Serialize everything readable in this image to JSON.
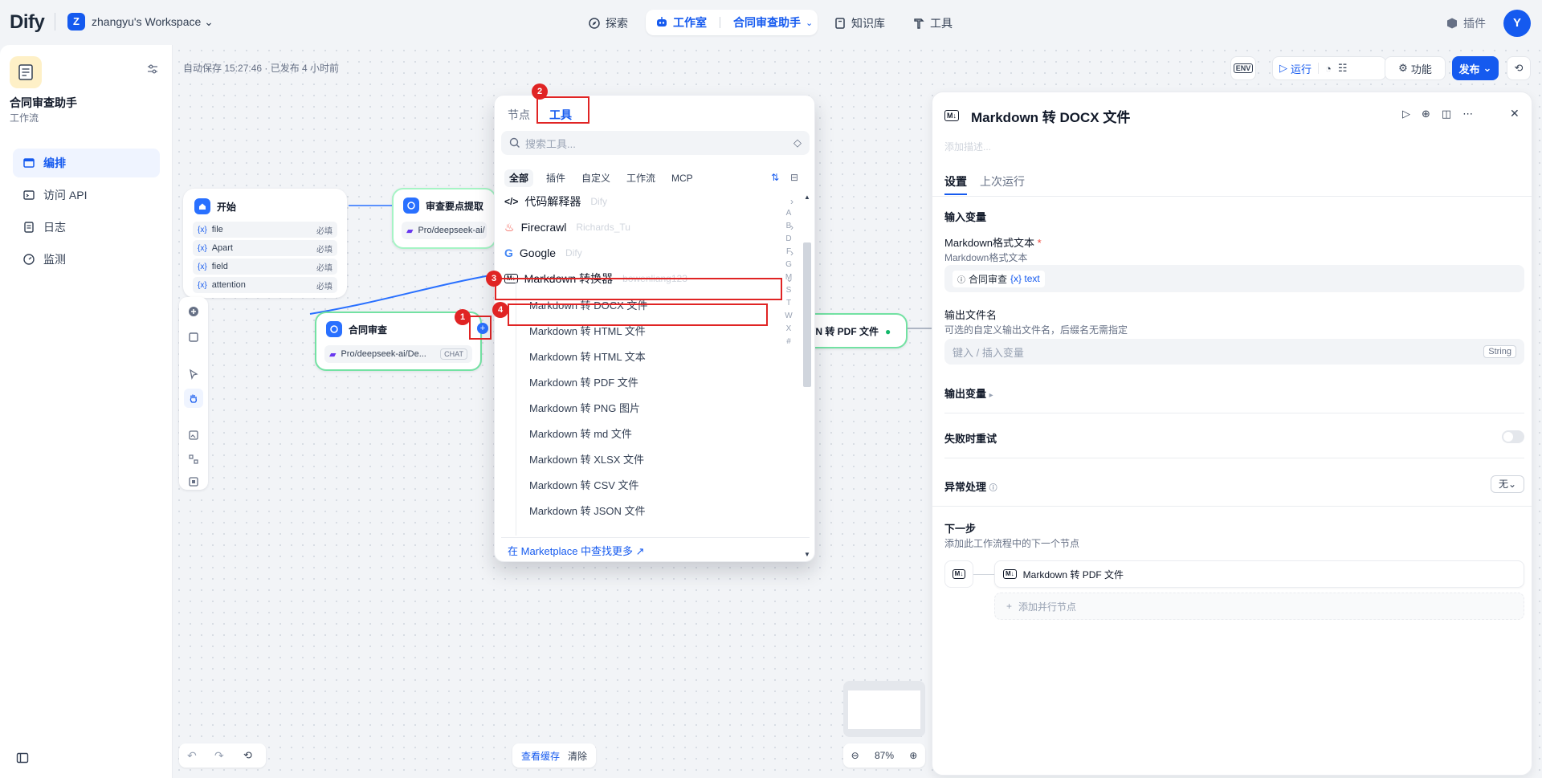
{
  "header": {
    "logo": "Dify",
    "workspace_initial": "Z",
    "workspace_name": "zhangyu's Workspace",
    "nav_explore": "探索",
    "nav_studio": "工作室",
    "nav_app": "合同审查助手",
    "nav_knowledge": "知识库",
    "nav_tools": "工具",
    "nav_plugins": "插件",
    "user_initial": "Y"
  },
  "sidebar": {
    "app_name": "合同审查助手",
    "app_type": "工作流",
    "items": [
      {
        "label": "编排"
      },
      {
        "label": "访问 API"
      },
      {
        "label": "日志"
      },
      {
        "label": "监测"
      }
    ]
  },
  "canvas": {
    "autosave": "自动保存 15:27:46 · 已发布 4 小时前",
    "start_node": {
      "title": "开始",
      "vars": [
        {
          "name": "file",
          "req": "必填"
        },
        {
          "name": "Apart",
          "req": "必填"
        },
        {
          "name": "field",
          "req": "必填"
        },
        {
          "name": "attention",
          "req": "必填"
        }
      ]
    },
    "extract_node": {
      "title": "审查要点提取",
      "model": "Pro/deepseek-ai/"
    },
    "review_node": {
      "title": "合同审查",
      "model": "Pro/deepseek-ai/De...",
      "tag": "CHAT"
    },
    "pdf_node": {
      "title": "WN 转 PDF 文件"
    },
    "view_cache": "查看缓存",
    "clear": "清除",
    "zoom": "87%"
  },
  "toolbar": {
    "env": "ENV",
    "run": "运行",
    "features": "功能",
    "publish": "发布"
  },
  "picker": {
    "tab_nodes": "节点",
    "tab_tools": "工具",
    "search_placeholder": "搜索工具...",
    "filters": [
      "全部",
      "插件",
      "自定义",
      "工作流",
      "MCP"
    ],
    "tools": [
      {
        "name": "代码解释器",
        "author": "Dify"
      },
      {
        "name": "Firecrawl",
        "author": "Richards_Tu"
      },
      {
        "name": "Google",
        "author": "Dify"
      },
      {
        "name": "Markdown 转换器",
        "author": "bowenliang123"
      }
    ],
    "sub_items": [
      "Markdown 转 DOCX 文件",
      "Markdown 转 HTML 文件",
      "Markdown 转 HTML 文本",
      "Markdown 转 PDF 文件",
      "Markdown 转 PNG 图片",
      "Markdown 转 md 文件",
      "Markdown 转 XLSX 文件",
      "Markdown 转 CSV 文件",
      "Markdown 转 JSON 文件"
    ],
    "alphabet": [
      "A",
      "B",
      "D",
      "F",
      "G",
      "M",
      "S",
      "T",
      "W",
      "X",
      "#"
    ],
    "footer": "在 Marketplace 中查找更多 ↗"
  },
  "annotations": [
    "1",
    "2",
    "3",
    "4"
  ],
  "panel": {
    "icon_text": "M↓",
    "title": "Markdown 转 DOCX 文件",
    "desc_placeholder": "添加描述...",
    "tab_settings": "设置",
    "tab_last_run": "上次运行",
    "input_vars": "输入变量",
    "md_label": "Markdown格式文本",
    "required_mark": "*",
    "md_sub": "Markdown格式文本",
    "md_var_node": "合同审查",
    "md_var_name": "{x} text",
    "filename_label": "输出文件名",
    "filename_sub": "可选的自定义输出文件名，后缀名无需指定",
    "filename_placeholder": "键入 / 插入变量",
    "filename_type": "String",
    "output_vars": "输出变量",
    "retry": "失败时重试",
    "error_handling": "异常处理",
    "error_value": "无",
    "next_step": "下一步",
    "next_step_sub": "添加此工作流程中的下一个节点",
    "next_node": "Markdown 转 PDF 文件",
    "add_parallel": "添加并行节点"
  }
}
